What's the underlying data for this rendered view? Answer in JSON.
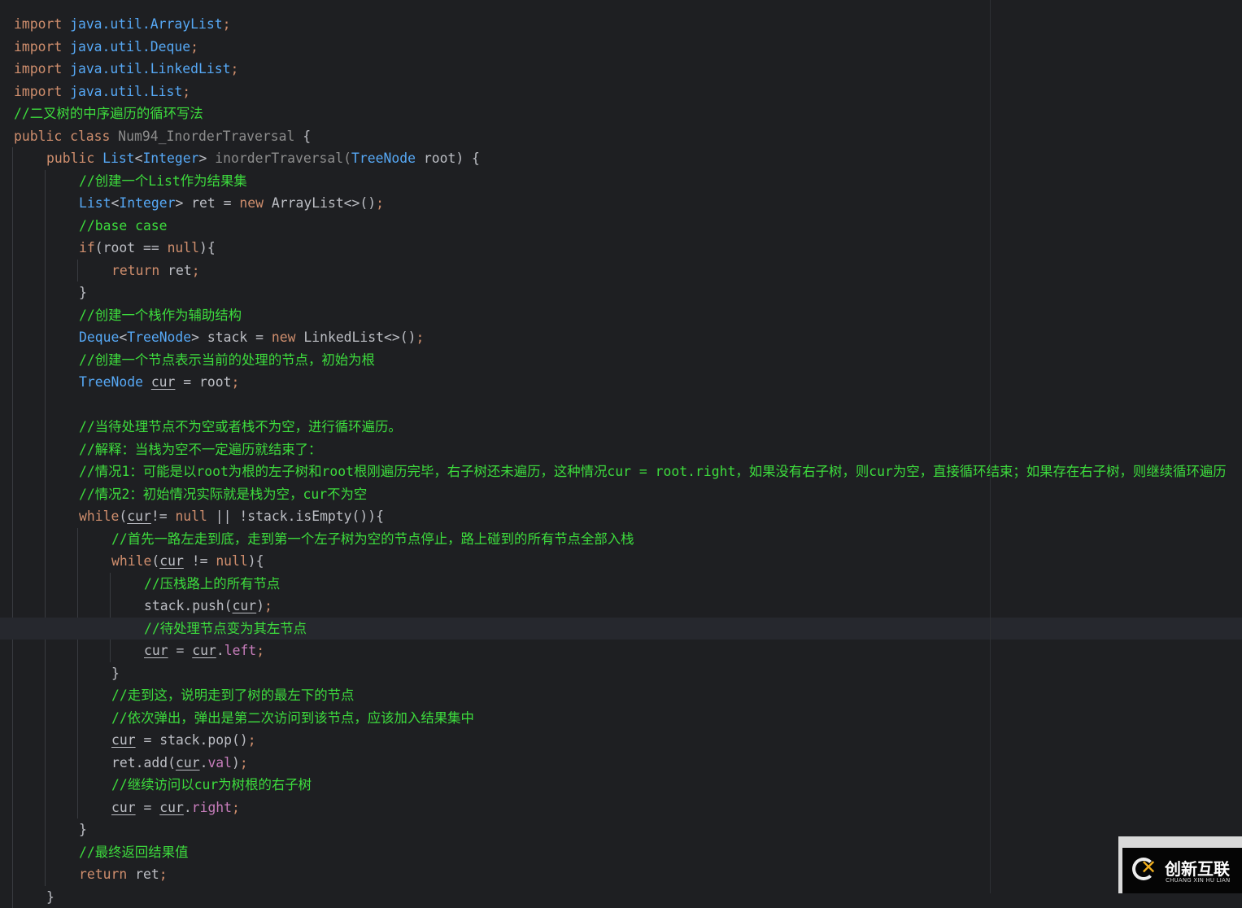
{
  "colors": {
    "background": "#1e1f22",
    "keyword": "#cf8e6d",
    "type": "#56a8f5",
    "comment": "#3ddc3d",
    "text": "#bcbec4",
    "field": "#c77dbb",
    "highlight_line": "#26282e"
  },
  "highlighted_line": 27,
  "lines": [
    {
      "indent": 0,
      "tokens": [
        [
          "import ",
          "k"
        ],
        [
          "java.util.ArrayList",
          "t"
        ],
        [
          ";",
          "s"
        ]
      ]
    },
    {
      "indent": 0,
      "tokens": [
        [
          "import ",
          "k"
        ],
        [
          "java.util.Deque",
          "t"
        ],
        [
          ";",
          "s"
        ]
      ]
    },
    {
      "indent": 0,
      "tokens": [
        [
          "import ",
          "k"
        ],
        [
          "java.util.LinkedList",
          "t"
        ],
        [
          ";",
          "s"
        ]
      ]
    },
    {
      "indent": 0,
      "tokens": [
        [
          "import ",
          "k"
        ],
        [
          "java.util.List",
          "t"
        ],
        [
          ";",
          "s"
        ]
      ]
    },
    {
      "indent": 0,
      "tokens": [
        [
          "//二叉树的中序遍历的循环写法",
          "c"
        ]
      ]
    },
    {
      "indent": 0,
      "tokens": [
        [
          "public class ",
          "k"
        ],
        [
          "Num94_InorderTraversal ",
          "g"
        ],
        [
          "{",
          "p"
        ]
      ]
    },
    {
      "indent": 1,
      "tokens": [
        [
          "public ",
          "k"
        ],
        [
          "List",
          "t"
        ],
        [
          "<",
          "p"
        ],
        [
          "Integer",
          "t"
        ],
        [
          "> ",
          "p"
        ],
        [
          "inorderTraversal(",
          "g"
        ],
        [
          "TreeNode ",
          "t"
        ],
        [
          "root) {",
          "p"
        ]
      ]
    },
    {
      "indent": 2,
      "tokens": [
        [
          "//创建一个List作为结果集",
          "c"
        ]
      ]
    },
    {
      "indent": 2,
      "tokens": [
        [
          "List",
          "t"
        ],
        [
          "<",
          "p"
        ],
        [
          "Integer",
          "t"
        ],
        [
          "> ret = ",
          "p"
        ],
        [
          "new ",
          "k"
        ],
        [
          "ArrayList<>()",
          "p"
        ],
        [
          ";",
          "s"
        ]
      ]
    },
    {
      "indent": 2,
      "tokens": [
        [
          "//base case",
          "c"
        ]
      ]
    },
    {
      "indent": 2,
      "tokens": [
        [
          "if",
          "k"
        ],
        [
          "(root == ",
          "p"
        ],
        [
          "null",
          "k"
        ],
        [
          "){",
          "p"
        ]
      ]
    },
    {
      "indent": 3,
      "tokens": [
        [
          "return ",
          "k"
        ],
        [
          "ret",
          "p"
        ],
        [
          ";",
          "s"
        ]
      ]
    },
    {
      "indent": 2,
      "tokens": [
        [
          "}",
          "p"
        ]
      ]
    },
    {
      "indent": 2,
      "tokens": [
        [
          "//创建一个栈作为辅助结构",
          "c"
        ]
      ]
    },
    {
      "indent": 2,
      "tokens": [
        [
          "Deque",
          "t"
        ],
        [
          "<",
          "p"
        ],
        [
          "TreeNode",
          "t"
        ],
        [
          "> stack = ",
          "p"
        ],
        [
          "new ",
          "k"
        ],
        [
          "LinkedList<>()",
          "p"
        ],
        [
          ";",
          "s"
        ]
      ]
    },
    {
      "indent": 2,
      "tokens": [
        [
          "//创建一个节点表示当前的处理的节点，初始为根",
          "c"
        ]
      ]
    },
    {
      "indent": 2,
      "tokens": [
        [
          "TreeNode ",
          "t"
        ],
        [
          "cur",
          "u"
        ],
        [
          " = root",
          "p"
        ],
        [
          ";",
          "s"
        ]
      ]
    },
    {
      "indent": 0,
      "tokens": []
    },
    {
      "indent": 2,
      "tokens": [
        [
          "//当待处理节点不为空或者栈不为空，进行循环遍历。",
          "c"
        ]
      ]
    },
    {
      "indent": 2,
      "tokens": [
        [
          "//解释：当栈为空不一定遍历就结束了：",
          "c"
        ]
      ]
    },
    {
      "indent": 2,
      "tokens": [
        [
          "//情况1：可能是以root为根的左子树和root根刚遍历完毕，右子树还未遍历，这种情况cur = root.right，如果没有右子树，则cur为空，直接循环结束；如果存在右子树，则继续循环遍历",
          "c"
        ]
      ]
    },
    {
      "indent": 2,
      "tokens": [
        [
          "//情况2：初始情况实际就是栈为空，cur不为空",
          "c"
        ]
      ]
    },
    {
      "indent": 2,
      "tokens": [
        [
          "while",
          "k"
        ],
        [
          "(",
          "p"
        ],
        [
          "cur",
          "u"
        ],
        [
          "!= ",
          "p"
        ],
        [
          "null ",
          "k"
        ],
        [
          "|| !stack.isEmpty()){",
          "p"
        ]
      ]
    },
    {
      "indent": 3,
      "tokens": [
        [
          "//首先一路左走到底，走到第一个左子树为空的节点停止，路上碰到的所有节点全部入栈",
          "c"
        ]
      ]
    },
    {
      "indent": 3,
      "tokens": [
        [
          "while",
          "k"
        ],
        [
          "(",
          "p"
        ],
        [
          "cur",
          "u"
        ],
        [
          " != ",
          "p"
        ],
        [
          "null",
          "k"
        ],
        [
          "){",
          "p"
        ]
      ]
    },
    {
      "indent": 4,
      "tokens": [
        [
          "//压栈路上的所有节点",
          "c"
        ]
      ]
    },
    {
      "indent": 4,
      "tokens": [
        [
          "stack.push(",
          "p"
        ],
        [
          "cur",
          "u"
        ],
        [
          ")",
          "p"
        ],
        [
          ";",
          "s"
        ]
      ]
    },
    {
      "indent": 4,
      "tokens": [
        [
          "//待处理节点变为其左节点",
          "c"
        ]
      ]
    },
    {
      "indent": 4,
      "tokens": [
        [
          "cur",
          "u"
        ],
        [
          " = ",
          "p"
        ],
        [
          "cur",
          "u"
        ],
        [
          ".",
          "p"
        ],
        [
          "left",
          "f"
        ],
        [
          ";",
          "s"
        ]
      ]
    },
    {
      "indent": 3,
      "tokens": [
        [
          "}",
          "p"
        ]
      ]
    },
    {
      "indent": 3,
      "tokens": [
        [
          "//走到这，说明走到了树的最左下的节点",
          "c"
        ]
      ]
    },
    {
      "indent": 3,
      "tokens": [
        [
          "//依次弹出，弹出是第二次访问到该节点，应该加入结果集中",
          "c"
        ]
      ]
    },
    {
      "indent": 3,
      "tokens": [
        [
          "cur",
          "u"
        ],
        [
          " = stack.pop()",
          "p"
        ],
        [
          ";",
          "s"
        ]
      ]
    },
    {
      "indent": 3,
      "tokens": [
        [
          "ret.add(",
          "p"
        ],
        [
          "cur",
          "u"
        ],
        [
          ".",
          "p"
        ],
        [
          "val",
          "f"
        ],
        [
          ")",
          "p"
        ],
        [
          ";",
          "s"
        ]
      ]
    },
    {
      "indent": 3,
      "tokens": [
        [
          "//继续访问以cur为树根的右子树",
          "c"
        ]
      ]
    },
    {
      "indent": 3,
      "tokens": [
        [
          "cur",
          "u"
        ],
        [
          " = ",
          "p"
        ],
        [
          "cur",
          "u"
        ],
        [
          ".",
          "p"
        ],
        [
          "right",
          "f"
        ],
        [
          ";",
          "s"
        ]
      ]
    },
    {
      "indent": 2,
      "tokens": [
        [
          "}",
          "p"
        ]
      ]
    },
    {
      "indent": 2,
      "tokens": [
        [
          "//最终返回结果值",
          "c"
        ]
      ]
    },
    {
      "indent": 2,
      "tokens": [
        [
          "return ",
          "k"
        ],
        [
          "ret",
          "p"
        ],
        [
          ";",
          "s"
        ]
      ]
    },
    {
      "indent": 1,
      "tokens": [
        [
          "}",
          "p"
        ]
      ]
    }
  ],
  "watermark": {
    "name_cn": "创新互联",
    "name_en": "CHUANG XIN HU LIAN"
  }
}
